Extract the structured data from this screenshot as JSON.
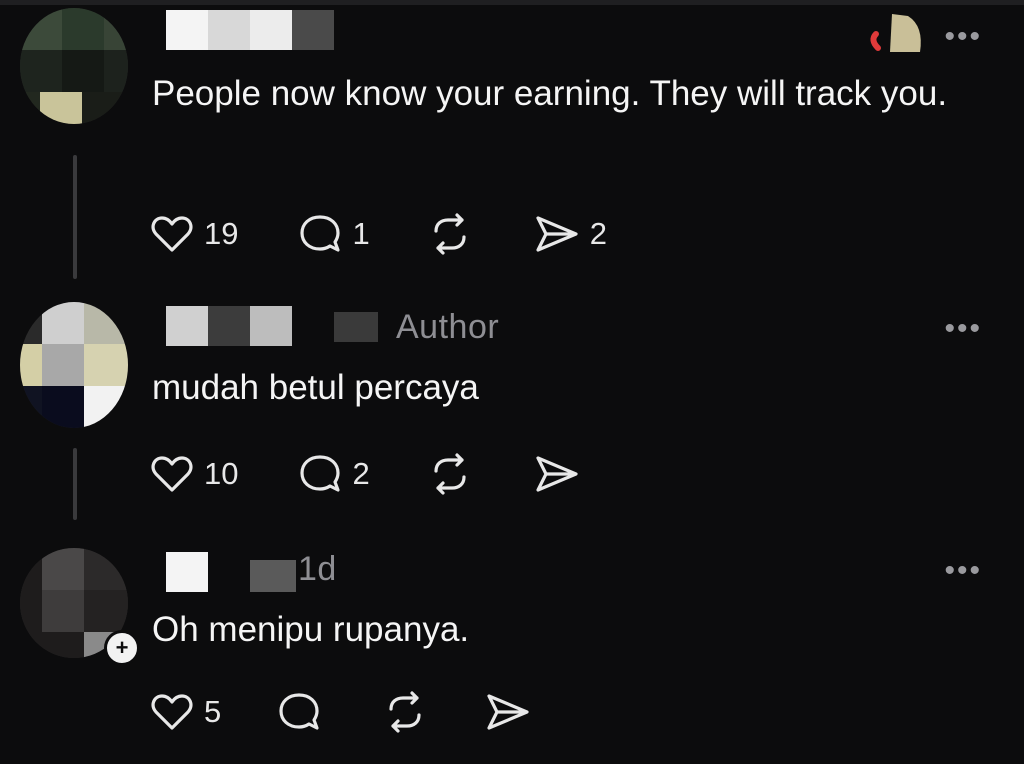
{
  "posts": [
    {
      "username": "",
      "tag": "",
      "text": "People now know your earning. They will track you.",
      "likes": "19",
      "replies": "1",
      "reposts": "",
      "shares": "2",
      "more_label": "•••"
    },
    {
      "username": "",
      "tag": "Author",
      "text": "mudah betul percaya",
      "likes": "10",
      "replies": "2",
      "reposts": "",
      "shares": "",
      "more_label": "•••"
    },
    {
      "username": "",
      "tag": "1d",
      "text": "Oh menipu rupanya.",
      "likes": "5",
      "replies": "",
      "reposts": "",
      "shares": "",
      "more_label": "•••"
    }
  ],
  "icons": {
    "like": "heart-icon",
    "reply": "comment-bubble-icon",
    "repost": "repost-icon",
    "share": "send-icon",
    "more": "more-options-icon"
  },
  "colors": {
    "background": "#0c0c0d",
    "text": "#f5f5f5",
    "muted": "#8e8e93",
    "thread_line": "#3a3a3c",
    "icon": "#e8e8e8"
  }
}
